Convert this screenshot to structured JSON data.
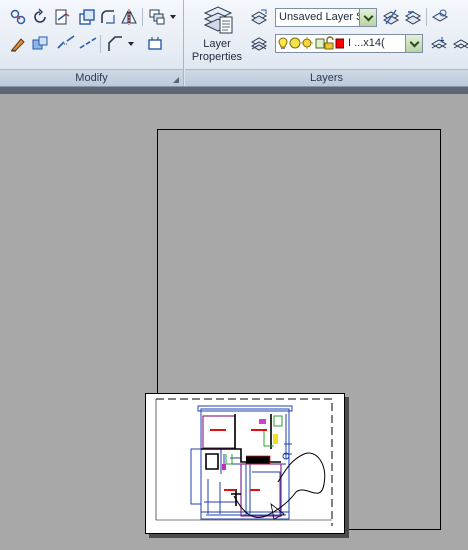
{
  "ribbon": {
    "modify": {
      "title": "Modify",
      "tools": [
        "move-icon",
        "rotate-icon",
        "trim-icon",
        "copy-icon",
        "fillet-icon",
        "mirror-icon",
        "array-icon",
        "erase-icon",
        "explode-icon",
        "break-icon",
        "join-icon",
        "chamfer-icon",
        "offset-icon"
      ]
    },
    "layers": {
      "title": "Layers",
      "layer_properties_label_line1": "Layer",
      "layer_properties_label_line2": "Properties",
      "layer_state_value": "Unsaved Layer S",
      "current_layer_value": "I ...x14(",
      "layer_color": "#ff0000"
    }
  },
  "colors": {
    "ribbon_bg": "#e6ecf4",
    "canvas_bg": "#a8a8a8",
    "combo_arrow": "#b8d4a4"
  }
}
